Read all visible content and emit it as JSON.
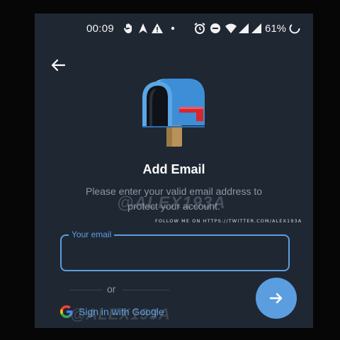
{
  "status_bar": {
    "time": "00:09",
    "battery": "61%",
    "icons": [
      "hand-icon",
      "navigation-icon",
      "alert-icon",
      "dot-icon",
      "alarm-icon",
      "dnd-icon",
      "wifi-icon",
      "signal-icon",
      "signal-icon",
      "battery-icon"
    ]
  },
  "header": {
    "back_icon": "arrow-left-icon"
  },
  "hero": {
    "icon": "mailbox-icon"
  },
  "title": "Add Email",
  "subtitle": "Please enter your valid email address to protect your account.",
  "watermark": "@ALEX193A",
  "follow_text": "FOLLOW ME ON HTTPS://TWITTER.COM/ALEX193A",
  "email_field": {
    "label": "Your email",
    "value": ""
  },
  "divider_text": "or",
  "google_button": {
    "label": "Sign in with Google",
    "icon": "google-icon"
  },
  "next_button": {
    "icon": "arrow-right-icon"
  },
  "colors": {
    "background": "#1f2733",
    "accent": "#5b9ee0",
    "text_muted": "#8d96a3"
  }
}
